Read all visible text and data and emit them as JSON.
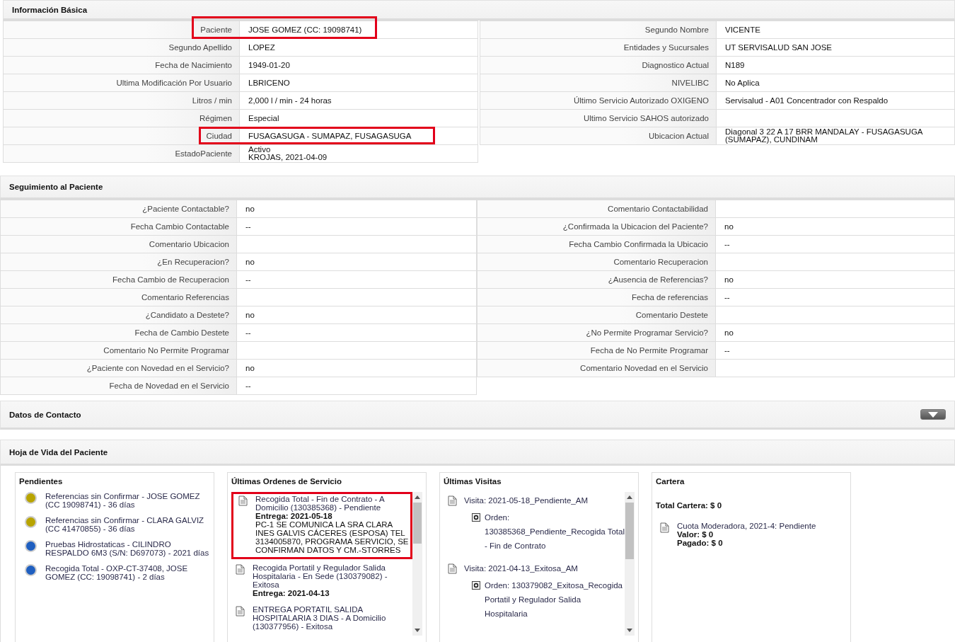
{
  "basic_info": {
    "title": "Información Básica",
    "left": [
      {
        "label": "Paciente",
        "value": "JOSE GOMEZ (CC: 19098741)",
        "highlighted": true
      },
      {
        "label": "Segundo Apellido",
        "value": "LOPEZ",
        "highlighted": false
      },
      {
        "label": "Fecha de Nacimiento",
        "value": "1949-01-20",
        "highlighted": false
      },
      {
        "label": "Ultima Modificación Por Usuario",
        "value": "LBRICENO",
        "highlighted": false
      },
      {
        "label": "Litros / min",
        "value": "2,000 l / min - 24 horas",
        "highlighted": false
      },
      {
        "label": "Régimen",
        "value": "Especial",
        "highlighted": false
      },
      {
        "label": "Ciudad",
        "value": "FUSAGASUGA - SUMAPAZ, FUSAGASUGA",
        "highlighted": true
      },
      {
        "label": "EstadoPaciente",
        "value": "Activo\nKROJAS, 2021-04-09",
        "highlighted": false
      }
    ],
    "right": [
      {
        "label": "Segundo Nombre",
        "value": "VICENTE",
        "highlighted": false
      },
      {
        "label": "Entidades y Sucursales",
        "value": "UT SERVISALUD SAN JOSE",
        "highlighted": false
      },
      {
        "label": "Diagnostico Actual",
        "value": "N189",
        "highlighted": false
      },
      {
        "label": "NIVELIBC",
        "value": "No Aplica",
        "highlighted": false
      },
      {
        "label": "Último Servicio Autorizado OXIGENO",
        "value": "Servisalud - A01 Concentrador con Respaldo",
        "highlighted": false
      },
      {
        "label": "Ultimo Servicio SAHOS autorizado",
        "highlighted": false
      },
      {
        "label": "Ubicacion Actual",
        "value": "Diagonal 3 22 A 17 BRR MANDALAY - FUSAGASUGA\n(SUMAPAZ), CUNDINAM",
        "highlighted": false
      }
    ]
  },
  "follow_up": {
    "title": "Seguimiento al Paciente",
    "left": [
      {
        "label": "¿Paciente Contactable?",
        "value": "no",
        "highlighted": false
      },
      {
        "label": "Fecha Cambio Contactable",
        "value": "--",
        "highlighted": false
      },
      {
        "label": "Comentario Ubicacion",
        "highlighted": false
      },
      {
        "label": "¿En Recuperacion?",
        "value": "no",
        "highlighted": false
      },
      {
        "label": "Fecha Cambio de Recuperacion",
        "value": "--",
        "highlighted": false
      },
      {
        "label": "Comentario Referencias",
        "highlighted": false
      },
      {
        "label": "¿Candidato a Destete?",
        "value": "no",
        "highlighted": false
      },
      {
        "label": "Fecha de Cambio Destete",
        "value": "--",
        "highlighted": false
      },
      {
        "label": "Comentario No Permite Programar",
        "highlighted": false
      },
      {
        "label": "¿Paciente con Novedad en el Servicio?",
        "value": "no",
        "highlighted": false
      },
      {
        "label": "Fecha de Novedad en el Servicio",
        "value": "--",
        "highlighted": false
      }
    ],
    "right": [
      {
        "label": "Comentario Contactabilidad",
        "highlighted": false
      },
      {
        "label": "¿Confirmada la Ubicacion del Paciente?",
        "value": "no",
        "highlighted": false
      },
      {
        "label": "Fecha Cambio Confirmada la Ubicacio",
        "value": "--",
        "highlighted": false
      },
      {
        "label": "Comentario Recuperacion",
        "highlighted": false
      },
      {
        "label": "¿Ausencia de Referencias?",
        "value": "no",
        "highlighted": false
      },
      {
        "label": "Fecha de referencias",
        "value": "--",
        "highlighted": false
      },
      {
        "label": "Comentario Destete",
        "highlighted": false
      },
      {
        "label": "¿No Permite Programar Servicio?",
        "value": "no",
        "highlighted": false
      },
      {
        "label": "Fecha de No Permite Programar",
        "value": "--",
        "highlighted": false
      },
      {
        "label": "Comentario Novedad en el Servicio",
        "highlighted": false
      }
    ]
  },
  "contact": {
    "title": "Datos de Contacto",
    "expanded": false
  },
  "history": {
    "title": "Hoja de Vida del Paciente",
    "pending": {
      "title": "Pendientes",
      "items": [
        {
          "text": "Referencias sin Confirmar - JOSE GOMEZ (CC 19098741) - 36 días",
          "color": "#b8a400"
        },
        {
          "text": "Referencias sin Confirmar - CLARA GALVIZ (CC 41470855) - 36 días",
          "color": "#b8a400"
        },
        {
          "text": "Pruebas Hidrostaticas - CILINDRO RESPALDO 6M3 (S/N: D697073) - 2021 días",
          "color": "#1f5fc0"
        },
        {
          "text": "Recogida Total - OXP-CT-37408, JOSE GOMEZ (CC: 19098741) - 2 días",
          "color": "#1f5fc0"
        }
      ]
    },
    "orders": {
      "title": "Últimas Ordenes de Servicio",
      "items": [
        {
          "title": "Recogida Total - Fin de Contrato - A Domicilio (130385368) - Pendiente",
          "delivery": "Entrega: 2021-05-18",
          "note": "PC-1 SE COMUNICA LA SRA CLARA INES GALVIS CÁCERES (ESPOSA) TEL 3134005870, PROGRAMA SERVICIO, SE CONFIRMAN DATOS Y CM.-STORRES",
          "highlighted": true
        },
        {
          "title": "Recogida Portatil y Regulador Salida Hospitalaria - En Sede (130379082) - Exitosa",
          "delivery": "Entrega: 2021-04-13",
          "highlighted": false
        },
        {
          "title": "ENTREGA PORTATIL SALIDA HOSPITALARIA 3 DIAS - A Domicilio (130377956) - Exitosa",
          "highlighted": false
        }
      ]
    },
    "visits": {
      "title": "Últimas Visitas",
      "items": [
        {
          "title": "Visita: 2021-05-18_Pendiente_AM",
          "order": "Orden: 130385368_Pendiente_Recogida Total - Fin de Contrato"
        },
        {
          "title": "Visita: 2021-04-13_Exitosa_AM",
          "order": "Orden: 130379082_Exitosa_Recogida Portatil y Regulador Salida Hospitalaria"
        }
      ]
    },
    "wallet": {
      "title": "Cartera",
      "total": "Total Cartera: $ 0",
      "items": [
        {
          "title": "Cuota Moderadora, 2021-4: Pendiente",
          "lines": [
            "Valor: $ 0",
            "Pagado: $ 0"
          ]
        }
      ]
    }
  }
}
